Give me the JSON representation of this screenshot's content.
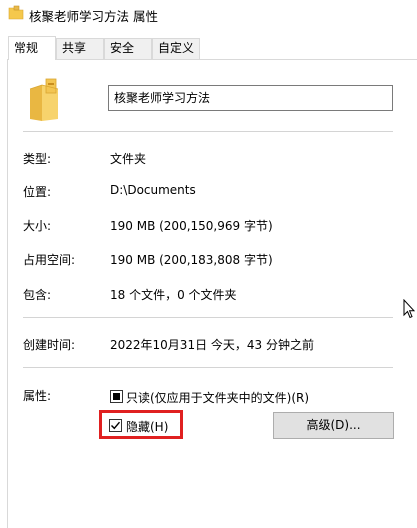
{
  "window": {
    "title": "核聚老师学习方法 属性"
  },
  "tabs": [
    {
      "label": "常规"
    },
    {
      "label": "共享"
    },
    {
      "label": "安全"
    },
    {
      "label": "自定义"
    }
  ],
  "general": {
    "folder_name": "核聚老师学习方法",
    "type_label": "类型:",
    "type_value": "文件夹",
    "location_label": "位置:",
    "location_value": "D:\\Documents",
    "size_label": "大小:",
    "size_value": "190 MB (200,150,969 字节)",
    "size_on_disk_label": "占用空间:",
    "size_on_disk_value": "190 MB (200,183,808 字节)",
    "contains_label": "包含:",
    "contains_value": "18 个文件，0 个文件夹",
    "created_label": "创建时间:",
    "created_value": "2022年10月31日 今天，43 分钟之前",
    "attributes_label": "属性:",
    "readonly_label": "只读(仅应用于文件夹中的文件)(R)",
    "readonly_state": "indeterminate",
    "hidden_label": "隐藏(H)",
    "hidden_checked": true,
    "advanced_label": "高级(D)..."
  },
  "colors": {
    "highlight": "#e02020",
    "folder": "#f5c84c"
  }
}
